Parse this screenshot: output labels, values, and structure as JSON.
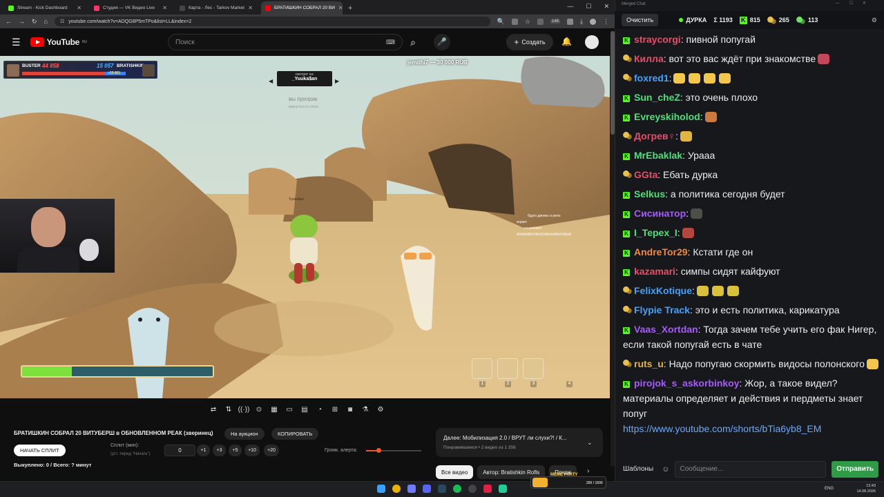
{
  "browser": {
    "tabs": [
      {
        "label": "Stream - Kick Dashboard",
        "icon": "kick-icon",
        "color": "#53fc18",
        "active": false
      },
      {
        "label": "Студия — VK Видео Live",
        "icon": "vk-video-icon",
        "color": "#ff3366",
        "active": false
      },
      {
        "label": "Карта - Лес - Tarkov Market",
        "icon": "tarkov-market-icon",
        "color": "#444444",
        "active": false
      },
      {
        "label": "БРАТИШКИН СОБРАЛ 20 ВИ",
        "icon": "youtube-icon",
        "color": "#ff0000",
        "active": true
      }
    ],
    "url": "youtube.com/watch?v=ADQG8P5mTPo&list=LL&index=2",
    "ext_badge": "146"
  },
  "youtube": {
    "logo": "YouTube",
    "logo_region": "RU",
    "search_placeholder": "Поиск",
    "create_label": "Создать"
  },
  "overlay": {
    "team_left": "BUSTER",
    "score_left": "44 858",
    "score_right": "15 057",
    "team_right": "BRATISHKIN",
    "score_delta": "+29 801",
    "donation": "jemithi7 — 30 000 RUB",
    "spectating_label": "смотрит на:",
    "spectating_name": "_Yuuka$an",
    "ghost_text": "вы призрак",
    "ghost_sub": "вернуться в статус",
    "player_tag": "Yuuka$an",
    "slots": [
      "1",
      "2",
      "3",
      "4"
    ],
    "health_pct": 0.26,
    "embedded_chat": [
      "будто дипинс в репо",
      "играет",
      "escundamn",
      "ФХФЫФЫХФЫХАФЫХАФЫХФЫА"
    ]
  },
  "controls": {
    "title": "БРАТИШКИН СОБРАЛ 20 ВИТУБЕРШ в ОБНОВЛЕННОМ РЕАК (зверинец)",
    "auction_label": "На аукцион",
    "copy_label": "КОПИРОВАТЬ",
    "start_split_label": "НАЧАТЬ СПЛИТ",
    "split_label": "Сплит (мин):",
    "split_hint": "(уст. перед \"Начать\")",
    "split_value": "0",
    "increments": [
      "+1",
      "+3",
      "+5",
      "+10",
      "+20"
    ],
    "volume_label": "Громк. алерта:",
    "volume_pct": 0.22,
    "bought": "Выкуплено: 0 / Всего: ? минут"
  },
  "next_video": {
    "title": "Далее: Мобилизация 2.0 / ВРУТ ли слухи?! / К...",
    "sub": "Понравившиеся • 2 видео из 1 356"
  },
  "chips": [
    "Все видео",
    "Автор: Bratishkin Rofls",
    "Похож"
  ],
  "meme_party": "MEME PARTY",
  "meme_count": "250 / 1500",
  "tray": {
    "lang": "ENG",
    "time": "13:43",
    "date": "14.08.2026"
  },
  "chat": {
    "window_title": "Merged Chat",
    "clear_label": "Очистить",
    "channel": "ДУРКА",
    "total": "Σ 1193",
    "kick_count": "815",
    "vk_count": "265",
    "other_count": "113",
    "placeholder": "Сообщение...",
    "templates_label": "Шаблоны",
    "send_label": "Отправить",
    "messages": [
      {
        "platform": "kick",
        "user": "straycorgi",
        "color": "#e94d6a",
        "text": ": пивной попугай",
        "emotes": []
      },
      {
        "platform": "vk",
        "user": "Килла",
        "color": "#e94d6a",
        "text": ": вот это вас ждёт при знакомстве",
        "emotes": [
          "#c4475b"
        ]
      },
      {
        "platform": "vk",
        "user": "foxred1",
        "color": "#3fa3ff",
        "text": ":",
        "emotes": [
          "#f3c84a",
          "#f3c84a",
          "#f3c84a",
          "#f3c84a"
        ]
      },
      {
        "platform": "kick",
        "user": "Sun_cheZ",
        "color": "#4be07a",
        "text": ": это очень плохо",
        "emotes": []
      },
      {
        "platform": "kick",
        "user": "Evreyskiholod",
        "color": "#4be07a",
        "text": ":",
        "emotes": [
          "#c97a3c"
        ]
      },
      {
        "platform": "vk",
        "user": "Догрев♀",
        "color": "#e94d6a",
        "text": ":",
        "emotes": [
          "#e2b440"
        ]
      },
      {
        "platform": "kick",
        "user": "MrEbaklak",
        "color": "#4be07a",
        "text": ": Урааа",
        "emotes": []
      },
      {
        "platform": "vk",
        "user": "GGta",
        "color": "#e94d6a",
        "text": ": Ебать дурка",
        "emotes": []
      },
      {
        "platform": "kick",
        "user": "Selkus",
        "color": "#4be07a",
        "text": ": а политика сегодня будет",
        "emotes": []
      },
      {
        "platform": "kick",
        "user": "Сисинатор",
        "color": "#a75bff",
        "text": ":",
        "emotes": [
          "#4a4f48"
        ]
      },
      {
        "platform": "kick",
        "user": "I_Tepex_I",
        "color": "#4be07a",
        "text": ":",
        "emotes": [
          "#b2473f"
        ]
      },
      {
        "platform": "kick",
        "user": "AndreTor29",
        "color": "#f08a3c",
        "text": ": Кстати где он",
        "emotes": []
      },
      {
        "platform": "kick",
        "user": "kazamari",
        "color": "#e94d6a",
        "text": ": симпы сидят кайфуют",
        "emotes": []
      },
      {
        "platform": "vk",
        "user": "FelixKotique",
        "color": "#3fa3ff",
        "text": ":",
        "emotes": [
          "#d9c23a",
          "#d9c23a",
          "#d9c23a"
        ]
      },
      {
        "platform": "vk",
        "user": "Flypie Track",
        "color": "#3fa3ff",
        "text": ": это и есть политика, карикатура",
        "emotes": []
      },
      {
        "platform": "kick",
        "user": "Vaas_Xortdan",
        "color": "#a75bff",
        "text": ": Тогда зачем тебе учить его фак Нигер, если такой попугай есть в чате",
        "emotes": []
      },
      {
        "platform": "vk",
        "user": "ruts_u",
        "color": "#e2b440",
        "text": ": Надо попугаю скормить видосы полонского",
        "emotes": [
          "#f3c84a"
        ]
      },
      {
        "platform": "kick",
        "user": "pirojok_s_askorbinkoy",
        "color": "#a75bff",
        "text": ": Жор, а такое видел? материалы определяет и действия и пердметы знает попуг",
        "link": "https://www.youtube.com/shorts/bTia6yb8_EM",
        "emotes": []
      }
    ]
  }
}
